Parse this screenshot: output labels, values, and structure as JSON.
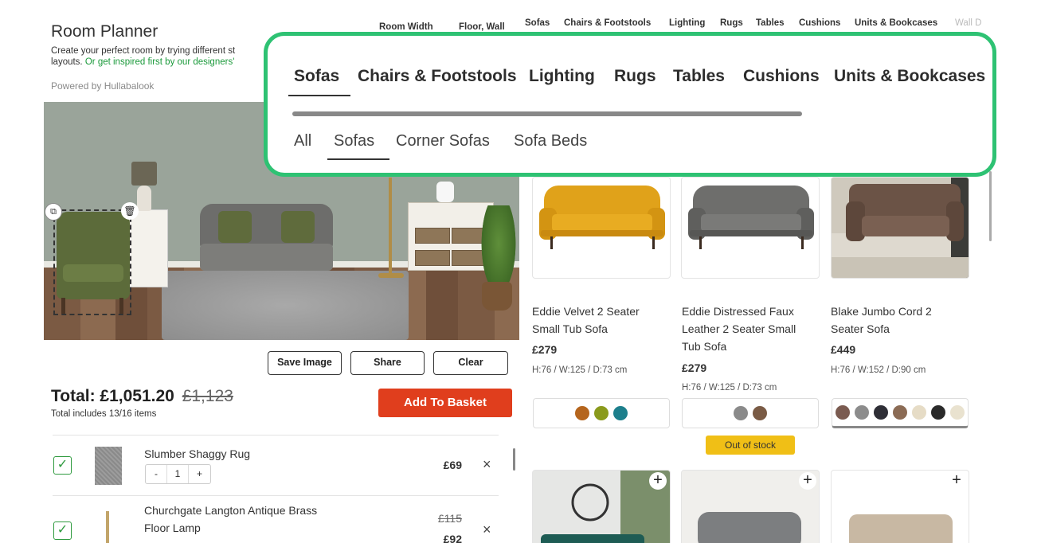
{
  "header": {
    "title": "Room Planner",
    "intro": "Create your perfect room by trying different st",
    "intro_line2": "layouts.",
    "intro_link": "Or get inspired first by our designers'",
    "powered": "Powered by Hullabalook"
  },
  "top_tabs": {
    "room_width": "Room Width",
    "floor_wall": "Floor, Wall",
    "sofas": "Sofas",
    "chairs": "Chairs & Footstools",
    "lighting": "Lighting",
    "rugs": "Rugs",
    "tables": "Tables",
    "cushions": "Cushions",
    "units": "Units & Bookcases",
    "wall": "Wall D"
  },
  "callout": {
    "categories": [
      "Sofas",
      "Chairs & Footstools",
      "Lighting",
      "Rugs",
      "Tables",
      "Cushions",
      "Units & Bookcases"
    ],
    "active_category": "Sofas",
    "subcategories": [
      "All",
      "Sofas",
      "Corner Sofas",
      "Sofa Beds"
    ],
    "active_subcategory": "Sofas",
    "accent_color": "#2ec273"
  },
  "actions": {
    "save_image": "Save Image",
    "share": "Share",
    "clear": "Clear"
  },
  "summary": {
    "total": "Total: £1,051.20",
    "was": "£1,123",
    "note": "Total includes 13/16 items",
    "add_to_basket": "Add To Basket",
    "basket_color": "#e03e1d"
  },
  "basket_items": [
    {
      "name": "Slumber Shaggy Rug",
      "qty": "1",
      "price": "£69",
      "checked": true
    },
    {
      "name": "Churchgate Langton Antique Brass",
      "name_line2": "Floor Lamp",
      "old_price": "£115",
      "price": "£92",
      "checked": true
    }
  ],
  "stepper": {
    "minus": "-",
    "plus": "+"
  },
  "products": [
    {
      "name_line1": "Eddie Velvet 2 Seater",
      "name_line2": "Small Tub Sofa",
      "price": "£279",
      "dims": "H:76 / W:125 / D:73 cm",
      "swatches": [
        "#b5651d",
        "#8a9a1c",
        "#1d7f8c"
      ]
    },
    {
      "name_line1": "Eddie Distressed Faux",
      "name_line2": "Leather 2 Seater Small",
      "name_line3": "Tub Sofa",
      "price": "£279",
      "dims": "H:76 / W:125 / D:73 cm",
      "swatches": [
        "#8a8a8a",
        "#7a5b45"
      ],
      "status": "Out of stock"
    },
    {
      "name_line1": "Blake Jumbo Cord 2",
      "name_line2": "Seater Sofa",
      "price": "£449",
      "dims": "H:76 / W:152 / D:90 cm",
      "swatches": [
        "#7a5b50",
        "#8c8c8c",
        "#2e2e36",
        "#8b6b55",
        "#e6dcc6",
        "#2a2a2a",
        "#e9e2cf"
      ]
    }
  ],
  "icons": {
    "check": "✓",
    "remove": "×",
    "plus": "+",
    "copy": "⧉",
    "trash": "🗑"
  }
}
